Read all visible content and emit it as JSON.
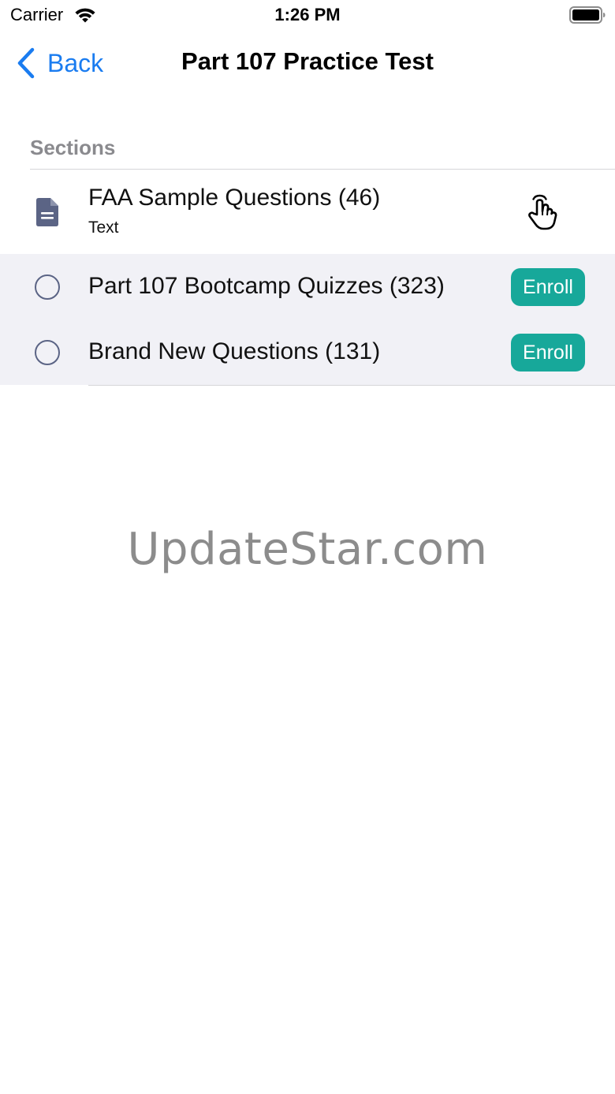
{
  "status_bar": {
    "carrier": "Carrier",
    "time": "1:26 PM",
    "wifi_icon": "wifi-icon",
    "battery_icon": "battery-full-icon"
  },
  "nav": {
    "back_label": "Back",
    "back_icon": "chevron-left-icon",
    "title": "Part 107 Practice Test",
    "accent_color": "#1a7cf0"
  },
  "sections": {
    "header": "Sections",
    "items": [
      {
        "title": "FAA Sample Questions (46)",
        "subtitle": "Text",
        "icon": "document-icon",
        "enrolled": true,
        "action_icon": "hand-pointer-icon"
      },
      {
        "title": "Part 107 Bootcamp Quizzes (323)",
        "icon": "radio-empty-icon",
        "enrolled": false,
        "action_label": "Enroll"
      },
      {
        "title": "Brand New Questions (131)",
        "icon": "radio-empty-icon",
        "enrolled": false,
        "action_label": "Enroll"
      }
    ],
    "enroll_color": "#17a89a",
    "locked_row_background": "#f1f1f6"
  },
  "watermark": "UpdateStar.com"
}
